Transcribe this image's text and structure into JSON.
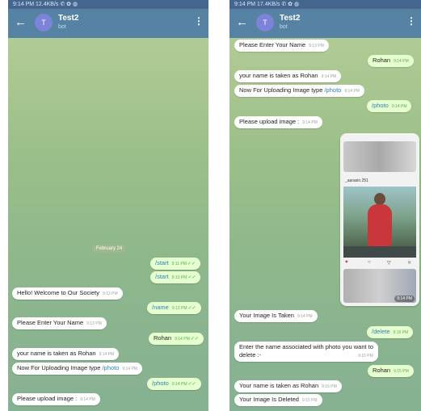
{
  "left": {
    "status_bar": "9:14 PM  12.4KB/s  ✆ ✿ ◍",
    "header": {
      "avatar_letter": "T",
      "title": "Test2",
      "subtitle": "bot"
    },
    "date_chip": "February 24",
    "messages": [
      {
        "text": "/start",
        "time": "9:11 PM",
        "out": true
      },
      {
        "text": "/start",
        "time": "9:13 PM",
        "out": true
      },
      {
        "text": "Hello! Welcome to Our Society",
        "time": "9:13 PM",
        "out": false
      },
      {
        "text": "/name",
        "time": "9:13 PM",
        "out": true
      },
      {
        "text": "Please Enter Your Name",
        "time": "9:13 PM",
        "out": false
      },
      {
        "text": "Rohan",
        "time": "9:14 PM",
        "out": true
      },
      {
        "text": "your name is taken as Rohan",
        "time": "9:14 PM",
        "out": false
      },
      {
        "text_prefix": "Now For Uploading Image type ",
        "text_cmd": "/photo",
        "time": "9:14 PM",
        "out": false
      },
      {
        "text": "/photo",
        "time": "9:14 PM",
        "out": true
      },
      {
        "text": "Please upload image :",
        "time": "9:14 PM",
        "out": false
      }
    ]
  },
  "right": {
    "status_bar": "9:14 PM  17.4KB/s  ✆ ✿ ◍",
    "header": {
      "avatar_letter": "T",
      "title": "Test2",
      "subtitle": "bot"
    },
    "messages": [
      {
        "text": "Please Enter Your Name",
        "time": "9:13 PM",
        "out": false
      },
      {
        "text": "Rohan",
        "time": "9:14 PM",
        "out": true
      },
      {
        "text": "your name is taken as Rohan",
        "time": "9:14 PM",
        "out": false
      },
      {
        "text_prefix": "Now For Uploading Image type ",
        "text_cmd": "/photo",
        "time": "9:14 PM",
        "out": false
      },
      {
        "text": "/photo",
        "time": "9:14 PM",
        "out": true
      },
      {
        "text": "Please upload image :",
        "time": "9:14 PM",
        "out": false
      },
      {
        "text": "Your Image Is Taken",
        "time": "9:14 PM",
        "out": false
      },
      {
        "text": "/delete",
        "time": "9:15 PM",
        "out": true
      },
      {
        "text_line1": "Enter the name associated with photo you want to",
        "text_line2": "delete :-",
        "time": "9:15 PM",
        "out": false
      },
      {
        "text": "Rohan",
        "time": "9:15 PM",
        "out": true
      },
      {
        "text": "Your name is taken as Rohan",
        "time": "9:15 PM",
        "out": false
      },
      {
        "text": "Your Image Is Deleted",
        "time": "9:15 PM",
        "out": false
      }
    ],
    "photo": {
      "username": "_aarasin.251",
      "time": "9:14 PM"
    }
  },
  "icons": {
    "back": "←",
    "more": "⋮",
    "ticks": "✓✓",
    "heart": "♥",
    "comment": "○",
    "share": "▽",
    "save": "⌑"
  }
}
